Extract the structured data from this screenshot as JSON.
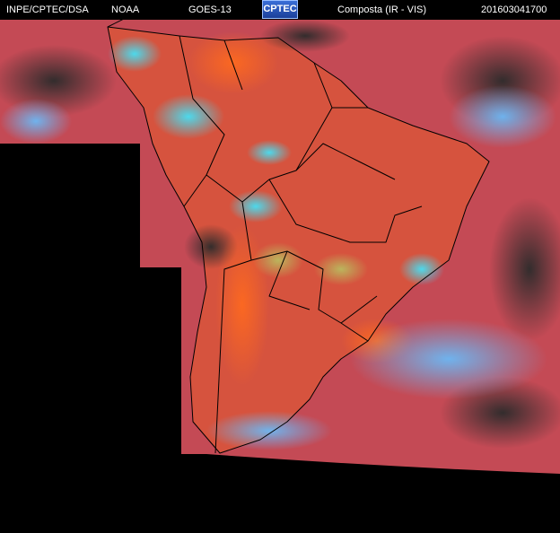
{
  "header": {
    "source": "INPE/CPTEC/DSA",
    "agency": "NOAA",
    "satellite": "GOES-13",
    "logo": "CPTEC",
    "product": "Composta (IR - VIS)",
    "timestamp": "201603041700"
  },
  "colors": {
    "background": "#000000",
    "land_warm": "#d9553c",
    "ocean_warm": "#c94a5a",
    "cloud_cold": "#5aa8e8",
    "cloud_cyan": "#3fd4ee",
    "clear_sky_dark": "#2a2a2a",
    "boundaries": "#000000"
  }
}
